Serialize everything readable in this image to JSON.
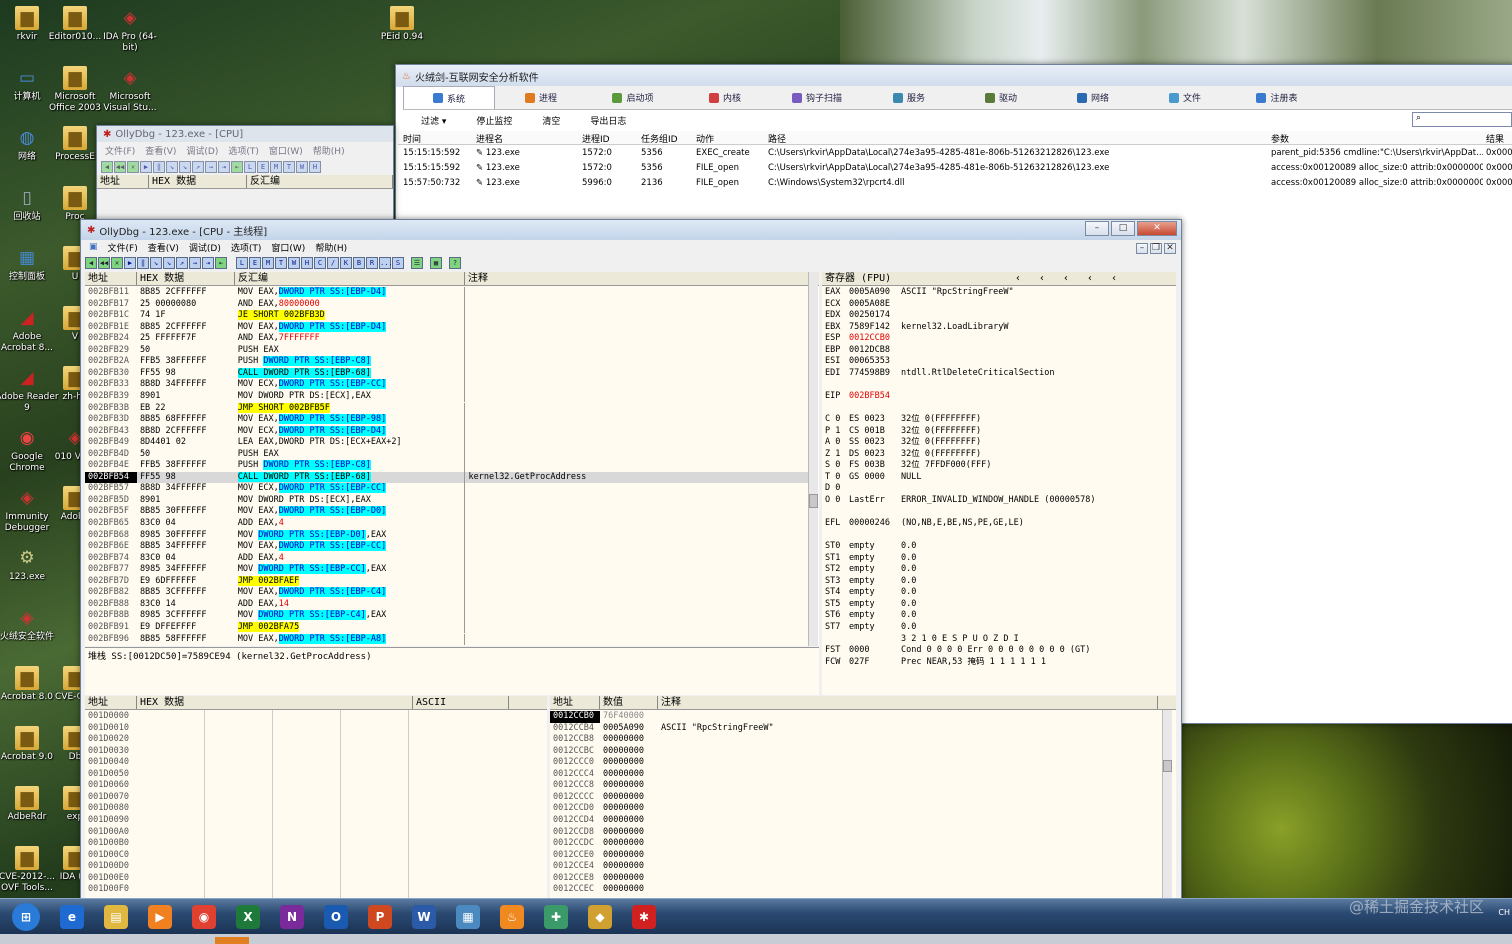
{
  "desktop": {
    "icons": [
      {
        "label": "rkvir",
        "kind": "folder"
      },
      {
        "label": "Editor010...",
        "kind": "folder"
      },
      {
        "label": "IDA Pro (64-bit)",
        "kind": "app"
      },
      {
        "label": "PEid 0.94",
        "kind": "folder"
      },
      {
        "label": "计算机",
        "kind": "computer"
      },
      {
        "label": "Microsoft Office 2003",
        "kind": "folder"
      },
      {
        "label": "Microsoft Visual Stu...",
        "kind": "app"
      },
      {
        "label": "网络",
        "kind": "network"
      },
      {
        "label": "ProcessE",
        "kind": "folder"
      },
      {
        "label": "回收站",
        "kind": "recycle"
      },
      {
        "label": "Proc",
        "kind": "folder"
      },
      {
        "label": "控制面板",
        "kind": "control"
      },
      {
        "label": "U",
        "kind": "folder"
      },
      {
        "label": "Adobe Acrobat 8...",
        "kind": "pdf"
      },
      {
        "label": "V",
        "kind": "folder"
      },
      {
        "label": "Adobe Reader 9",
        "kind": "pdf"
      },
      {
        "label": "zh-ha",
        "kind": "folder"
      },
      {
        "label": "Google Chrome",
        "kind": "chrome"
      },
      {
        "label": "010 V3.1",
        "kind": "app"
      },
      {
        "label": "Immunity Debugger",
        "kind": "app"
      },
      {
        "label": "Adobe",
        "kind": "folder"
      },
      {
        "label": "123.exe",
        "kind": "exe"
      },
      {
        "label": "火绒安全软件",
        "kind": "app"
      },
      {
        "label": "Acrobat 8.0",
        "kind": "folder"
      },
      {
        "label": "CVE-OVF",
        "kind": "folder"
      },
      {
        "label": "Acrobat 9.0",
        "kind": "folder"
      },
      {
        "label": "Db",
        "kind": "folder"
      },
      {
        "label": "AdbeRdr",
        "kind": "folder"
      },
      {
        "label": "exp",
        "kind": "folder"
      },
      {
        "label": "CVE-2012-... OVF Tools...",
        "kind": "folder"
      },
      {
        "label": "IDA (8.",
        "kind": "folder"
      }
    ]
  },
  "huorong": {
    "title": "火绒剑-互联网安全分析软件",
    "tabs": [
      "系统",
      "进程",
      "启动项",
      "内核",
      "钩子扫描",
      "服务",
      "驱动",
      "网络",
      "文件",
      "注册表"
    ],
    "toolbar": [
      "过滤 ▾",
      "停止监控",
      "清空",
      "导出日志"
    ],
    "columns": [
      "时间",
      "进程名",
      "进程ID",
      "任务组ID",
      "动作",
      "路径",
      "参数",
      "结果"
    ],
    "rows": [
      [
        "15:15:15:592",
        "123.exe",
        "1572:0",
        "5356",
        "EXEC_create",
        "C:\\Users\\rkvir\\AppData\\Local\\274e3a95-4285-481e-806b-51263212826\\123.exe",
        "parent_pid:5356 cmdline:\"C:\\Users\\rkvir\\AppDat...",
        "0x0000"
      ],
      [
        "15:15:15:592",
        "123.exe",
        "1572:0",
        "5356",
        "FILE_open",
        "C:\\Users\\rkvir\\AppData\\Local\\274e3a95-4285-481e-806b-51263212826\\123.exe",
        "access:0x00120089 alloc_size:0 attrib:0x00000000...",
        "0x0000"
      ],
      [
        "15:57:50:732",
        "123.exe",
        "5996:0",
        "2136",
        "FILE_open",
        "C:\\Windows\\System32\\rpcrt4.dll",
        "access:0x00120089 alloc_size:0 attrib:0x00000000...",
        "0x0000"
      ]
    ]
  },
  "olly_back": {
    "title": "OllyDbg - 123.exe - [CPU]",
    "menu": [
      "文件(F)",
      "查看(V)",
      "调试(D)",
      "选项(T)",
      "窗口(W)",
      "帮助(H)"
    ],
    "cols": [
      "地址",
      "HEX 数据",
      "反汇编"
    ]
  },
  "olly": {
    "title": "OllyDbg - 123.exe - [CPU - 主线程]",
    "menu": [
      "文件(F)",
      "查看(V)",
      "调试(D)",
      "选项(T)",
      "窗口(W)",
      "帮助(H)"
    ],
    "toolbar_letters": [
      "L",
      "E",
      "M",
      "T",
      "W",
      "H",
      "C",
      "/",
      "K",
      "B",
      "R",
      "...",
      "S"
    ],
    "disasm_cols": [
      "地址",
      "HEX 数据",
      "反汇编",
      "注释"
    ],
    "disasm": [
      [
        "002BFB11",
        "8B85 2CFFFFFF",
        "MOV EAX,|DWORD PTR SS:[EBP-D4]",
        "",
        ""
      ],
      [
        "002BFB17",
        "25 00000080",
        "AND EAX,|80000000",
        "",
        ""
      ],
      [
        "002BFB1C",
        "74 1F",
        "|JE SHORT 002BFB3D",
        "",
        "j"
      ],
      [
        "002BFB1E",
        "8B85 2CFFFFFF",
        "MOV EAX,|DWORD PTR SS:[EBP-D4]",
        "",
        ""
      ],
      [
        "002BFB24",
        "25 FFFFFF7F",
        "AND EAX,|7FFFFFFF",
        "",
        ""
      ],
      [
        "002BFB29",
        "50",
        "PUSH EAX",
        "",
        ""
      ],
      [
        "002BFB2A",
        "FFB5 38FFFFFF",
        "PUSH |DWORD PTR SS:[EBP-C8]",
        "",
        ""
      ],
      [
        "002BFB30",
        "FF55 98",
        "|CALL DWORD PTR SS:[EBP-68]",
        "",
        "c"
      ],
      [
        "002BFB33",
        "8B8D 34FFFFFF",
        "MOV ECX,|DWORD PTR SS:[EBP-CC]",
        "",
        ""
      ],
      [
        "002BFB39",
        "8901",
        "MOV DWORD PTR DS:[ECX],EAX",
        "",
        ""
      ],
      [
        "002BFB3B",
        "EB 22",
        "|JMP SHORT 002BFB5F",
        "",
        "j"
      ],
      [
        "002BFB3D",
        "8B85 68FFFFFF",
        "MOV EAX,|DWORD PTR SS:[EBP-98]",
        "",
        ""
      ],
      [
        "002BFB43",
        "8B8D 2CFFFFFF",
        "MOV ECX,|DWORD PTR SS:[EBP-D4]",
        "",
        ""
      ],
      [
        "002BFB49",
        "8D4401 02",
        "LEA EAX,DWORD PTR DS:[ECX+EAX+2]",
        "",
        ""
      ],
      [
        "002BFB4D",
        "50",
        "PUSH EAX",
        "",
        ""
      ],
      [
        "002BFB4E",
        "FFB5 38FFFFFF",
        "PUSH |DWORD PTR SS:[EBP-C8]",
        "",
        ""
      ],
      [
        "002BFB54",
        "FF55 98",
        "|CALL DWORD PTR SS:[EBP-68]",
        "kernel32.GetProcAddress",
        "cs"
      ],
      [
        "002BFB57",
        "8B8D 34FFFFFF",
        "MOV ECX,|DWORD PTR SS:[EBP-CC]",
        "",
        ""
      ],
      [
        "002BFB5D",
        "8901",
        "MOV DWORD PTR DS:[ECX],EAX",
        "",
        ""
      ],
      [
        "002BFB5F",
        "8B85 30FFFFFF",
        "MOV EAX,|DWORD PTR SS:[EBP-D0]",
        "",
        ""
      ],
      [
        "002BFB65",
        "83C0 04",
        "ADD EAX,|4",
        "",
        ""
      ],
      [
        "002BFB68",
        "8985 30FFFFFF",
        "MOV |DWORD PTR SS:[EBP-D0]|,EAX",
        "",
        ""
      ],
      [
        "002BFB6E",
        "8B85 34FFFFFF",
        "MOV EAX,|DWORD PTR SS:[EBP-CC]",
        "",
        ""
      ],
      [
        "002BFB74",
        "83C0 04",
        "ADD EAX,|4",
        "",
        ""
      ],
      [
        "002BFB77",
        "8985 34FFFFFF",
        "MOV |DWORD PTR SS:[EBP-CC]|,EAX",
        "",
        ""
      ],
      [
        "002BFB7D",
        "E9 6DFFFFFF",
        "|JMP 002BFAEF",
        "",
        "j"
      ],
      [
        "002BFB82",
        "8B85 3CFFFFFF",
        "MOV EAX,|DWORD PTR SS:[EBP-C4]",
        "",
        ""
      ],
      [
        "002BFB88",
        "83C0 14",
        "ADD EAX,|14",
        "",
        ""
      ],
      [
        "002BFB8B",
        "8985 3CFFFFFF",
        "MOV |DWORD PTR SS:[EBP-C4]|,EAX",
        "",
        ""
      ],
      [
        "002BFB91",
        "E9 DFFEFFFF",
        "|JMP 002BFA75",
        "",
        "j"
      ],
      [
        "002BFB96",
        "8B85 58FFFFFF",
        "MOV EAX,|DWORD PTR SS:[EBP-A8]",
        "",
        ""
      ]
    ],
    "info": "堆栈 SS:[0012DC50]=7589CE94 (kernel32.GetProcAddress)",
    "reg_title": "寄存器 (FPU)",
    "regs": [
      [
        "EAX",
        "0005A090",
        "ASCII \"RpcStringFreeW\""
      ],
      [
        "ECX",
        "0005A08E",
        ""
      ],
      [
        "EDX",
        "00250174",
        ""
      ],
      [
        "EBX",
        "7589F142",
        "kernel32.LoadLibraryW"
      ],
      [
        "ESP",
        "0012CCB0",
        ""
      ],
      [
        "EBP",
        "0012DCB8",
        ""
      ],
      [
        "ESI",
        "00065353",
        ""
      ],
      [
        "EDI",
        "774598B9",
        "ntdll.RtlDeleteCriticalSection"
      ],
      [
        "",
        "",
        " "
      ],
      [
        "EIP",
        "002BFB54",
        ""
      ],
      [
        "",
        "",
        " "
      ],
      [
        "C 0",
        "ES 0023",
        "32位 0(FFFFFFFF)"
      ],
      [
        "P 1",
        "CS 001B",
        "32位 0(FFFFFFFF)"
      ],
      [
        "A 0",
        "SS 0023",
        "32位 0(FFFFFFFF)"
      ],
      [
        "Z 1",
        "DS 0023",
        "32位 0(FFFFFFFF)"
      ],
      [
        "S 0",
        "FS 003B",
        "32位 7FFDF000(FFF)"
      ],
      [
        "T 0",
        "GS 0000",
        "NULL"
      ],
      [
        "D 0",
        "",
        ""
      ],
      [
        "O 0",
        "LastErr",
        "ERROR_INVALID_WINDOW_HANDLE (00000578)"
      ],
      [
        "",
        "",
        " "
      ],
      [
        "EFL",
        "00000246",
        "(NO,NB,E,BE,NS,PE,GE,LE)"
      ],
      [
        "",
        "",
        " "
      ],
      [
        "ST0",
        "empty",
        "0.0"
      ],
      [
        "ST1",
        "empty",
        "0.0"
      ],
      [
        "ST2",
        "empty",
        "0.0"
      ],
      [
        "ST3",
        "empty",
        "0.0"
      ],
      [
        "ST4",
        "empty",
        "0.0"
      ],
      [
        "ST5",
        "empty",
        "0.0"
      ],
      [
        "ST6",
        "empty",
        "0.0"
      ],
      [
        "ST7",
        "empty",
        "0.0"
      ],
      [
        "",
        "",
        "      3 2 1 0      E S P U O Z D I"
      ],
      [
        "FST",
        "0000",
        "Cond 0 0 0 0  Err 0 0 0 0 0 0 0 0  (GT)"
      ],
      [
        "FCW",
        "027F",
        "Prec NEAR,53  掩码    1 1 1 1 1 1"
      ]
    ],
    "dump_cols": [
      "地址",
      "HEX 数据",
      "ASCII"
    ],
    "dump": [
      "001D0000",
      "001D0010",
      "001D0020",
      "001D0030",
      "001D0040",
      "001D0050",
      "001D0060",
      "001D0070",
      "001D0080",
      "001D0090",
      "001D00A0",
      "001D00B0",
      "001D00C0",
      "001D00D0",
      "001D00E0",
      "001D00F0"
    ],
    "stack_cols": [
      "地址",
      "数值",
      "注释"
    ],
    "stack": [
      [
        "0012CCB0",
        "76F40000",
        ""
      ],
      [
        "0012CCB4",
        "0005A090",
        "ASCII \"RpcStringFreeW\""
      ],
      [
        "0012CCB8",
        "00000000",
        ""
      ],
      [
        "0012CCBC",
        "00000000",
        ""
      ],
      [
        "0012CCC0",
        "00000000",
        ""
      ],
      [
        "0012CCC4",
        "00000000",
        ""
      ],
      [
        "0012CCC8",
        "00000000",
        ""
      ],
      [
        "0012CCCC",
        "00000000",
        ""
      ],
      [
        "0012CCD0",
        "00000000",
        ""
      ],
      [
        "0012CCD4",
        "00000000",
        ""
      ],
      [
        "0012CCD8",
        "00000000",
        ""
      ],
      [
        "0012CCDC",
        "00000000",
        ""
      ],
      [
        "0012CCE0",
        "00000000",
        ""
      ],
      [
        "0012CCE4",
        "00000000",
        ""
      ],
      [
        "0012CCE8",
        "00000000",
        ""
      ],
      [
        "0012CCEC",
        "00000000",
        ""
      ]
    ]
  },
  "taskbar": {
    "items": [
      {
        "name": "start",
        "glyph": "⊞",
        "color": "#2a7ad8"
      },
      {
        "name": "ie",
        "glyph": "e",
        "color": "#1e6ad0"
      },
      {
        "name": "explorer",
        "glyph": "▤",
        "color": "#e0b840"
      },
      {
        "name": "media",
        "glyph": "▶",
        "color": "#f08020"
      },
      {
        "name": "chrome",
        "glyph": "◉",
        "color": "#e04030"
      },
      {
        "name": "excel",
        "glyph": "X",
        "color": "#1e7a3a"
      },
      {
        "name": "onenote",
        "glyph": "N",
        "color": "#7a2a9a"
      },
      {
        "name": "outlook",
        "glyph": "O",
        "color": "#1a5ab0"
      },
      {
        "name": "powerpoint",
        "glyph": "P",
        "color": "#d04820"
      },
      {
        "name": "word",
        "glyph": "W",
        "color": "#2a5aa8"
      },
      {
        "name": "network",
        "glyph": "▦",
        "color": "#4a8ac0"
      },
      {
        "name": "huorong",
        "glyph": "♨",
        "color": "#f08a20"
      },
      {
        "name": "tool",
        "glyph": "✚",
        "color": "#3a9a6a"
      },
      {
        "name": "shield",
        "glyph": "◆",
        "color": "#d0a030"
      },
      {
        "name": "ollydbg",
        "glyph": "✱",
        "color": "#d02020"
      }
    ],
    "watermark": "@稀土掘金技术社区",
    "tray": "CH"
  }
}
